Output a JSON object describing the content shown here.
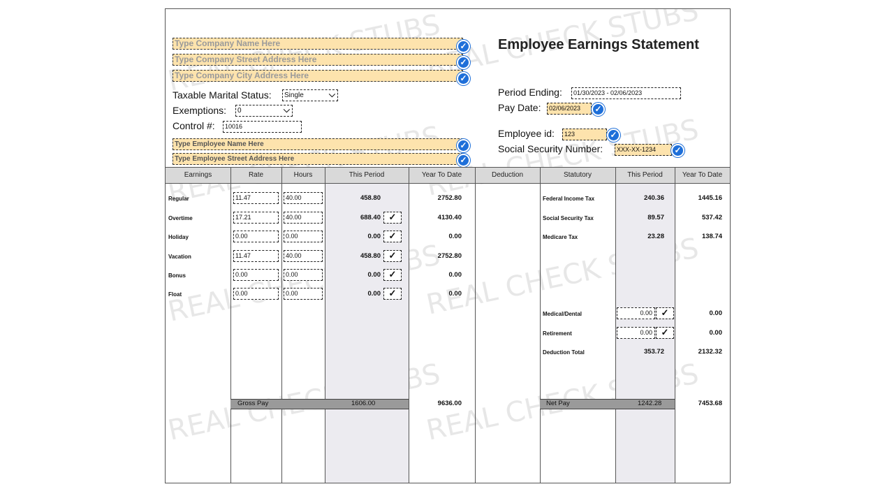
{
  "company": {
    "name_placeholder": "Type Company Name Here",
    "street_placeholder": "Type Company Street Address Here",
    "city_placeholder": "Type Company City Address Here"
  },
  "title": "Employee Earnings Statement",
  "info": {
    "marital_label": "Taxable Marital Status:",
    "marital_value": "Single",
    "exemptions_label": "Exemptions:",
    "exemptions_value": "0",
    "control_label": "Control #:",
    "control_value": "10016",
    "period_label": "Period Ending:",
    "period_value": "01/30/2023 - 02/06/2023",
    "paydate_label": "Pay Date:",
    "paydate_value": "02/06/2023",
    "empid_label": "Employee id:",
    "empid_value": "123",
    "ssn_label": "Social Security Number:",
    "ssn_value": "XXX-XX-1234"
  },
  "employee": {
    "name_placeholder": "Type Employee Name Here",
    "street_placeholder": "Type Employee Street Address Here"
  },
  "headers": {
    "earnings": "Earnings",
    "rate": "Rate",
    "hours": "Hours",
    "this_period": "This Period",
    "ytd": "Year To Date",
    "deduction": "Deduction",
    "statutory": "Statutory",
    "this_period2": "This Period",
    "ytd2": "Year To Date"
  },
  "earnings": [
    {
      "label": "Regular",
      "rate": "11.47",
      "hours": "40.00",
      "period": "458.80",
      "ytd": "2752.80"
    },
    {
      "label": "Overtime",
      "rate": "17.21",
      "hours": "40.00",
      "period": "688.40",
      "ytd": "4130.40"
    },
    {
      "label": "Holiday",
      "rate": "0.00",
      "hours": "0.00",
      "period": "0.00",
      "ytd": "0.00"
    },
    {
      "label": "Vacation",
      "rate": "11.47",
      "hours": "40.00",
      "period": "458.80",
      "ytd": "2752.80"
    },
    {
      "label": "Bonus",
      "rate": "0.00",
      "hours": "0.00",
      "period": "0.00",
      "ytd": "0.00"
    },
    {
      "label": "Float",
      "rate": "0.00",
      "hours": "0.00",
      "period": "0.00",
      "ytd": "0.00"
    }
  ],
  "statutory": [
    {
      "label": "Federal Income Tax",
      "period": "240.36",
      "ytd": "1445.16"
    },
    {
      "label": "Social Security Tax",
      "period": "89.57",
      "ytd": "537.42"
    },
    {
      "label": "Medicare Tax",
      "period": "23.28",
      "ytd": "138.74"
    }
  ],
  "deductions": [
    {
      "label": "Medical/Dental",
      "period": "0.00",
      "ytd": "0.00"
    },
    {
      "label": "Retirement",
      "period": "0.00",
      "ytd": "0.00"
    },
    {
      "label": "Deduction Total",
      "period": "353.72",
      "ytd": "2132.32"
    }
  ],
  "totals": {
    "gross_label": "Gross Pay",
    "gross_period": "1606.00",
    "gross_ytd": "9636.00",
    "net_label": "Net Pay",
    "net_period": "1242.28",
    "net_ytd": "7453.68"
  },
  "watermark": "REAL CHECK STUBS"
}
